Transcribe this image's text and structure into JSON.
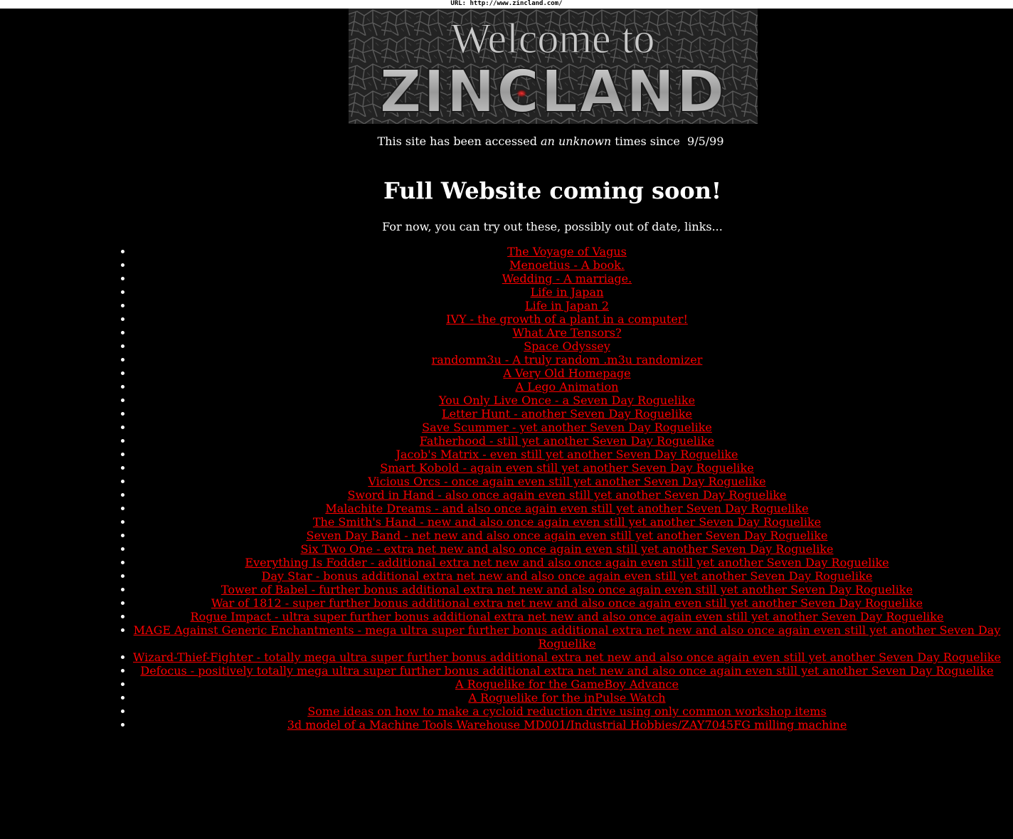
{
  "url_bar": {
    "text": "URL: http://www.zincland.com/"
  },
  "banner": {
    "line1": "Welcome to",
    "line2": "ZINCLAND"
  },
  "counter": {
    "before": "This site has been accessed ",
    "count": "an unknown",
    "after": " times since  9/5/99"
  },
  "headline": "Full Website coming soon!",
  "intro": "For now, you can try out these, possibly out of date, links...",
  "colors": {
    "background": "#000000",
    "text": "#ffffff",
    "link": "#ff0000"
  },
  "links": [
    "The Voyage of Vagus",
    "Menoetius - A book.",
    "Wedding - A marriage.",
    "Life in Japan",
    "Life in Japan 2",
    "IVY - the growth of a plant in a computer!",
    "What Are Tensors?",
    "Space Odyssey",
    "randomm3u - A truly random .m3u randomizer",
    "A Very Old Homepage",
    "A Lego Animation",
    "You Only Live Once - a Seven Day Roguelike",
    "Letter Hunt - another Seven Day Roguelike",
    "Save Scummer - yet another Seven Day Roguelike",
    "Fatherhood - still yet another Seven Day Roguelike",
    "Jacob's Matrix - even still yet another Seven Day Roguelike",
    "Smart Kobold - again even still yet another Seven Day Roguelike",
    "Vicious Orcs - once again even still yet another Seven Day Roguelike",
    "Sword in Hand - also once again even still yet another Seven Day Roguelike",
    "Malachite Dreams - and also once again even still yet another Seven Day Roguelike",
    "The Smith's Hand - new and also once again even still yet another Seven Day Roguelike",
    "Seven Day Band - net new and also once again even still yet another Seven Day Roguelike",
    "Six Two One - extra net new and also once again even still yet another Seven Day Roguelike",
    "Everything Is Fodder - additional extra net new and also once again even still yet another Seven Day Roguelike",
    "Day Star - bonus additional extra net new and also once again even still yet another Seven Day Roguelike",
    "Tower of Babel - further bonus additional extra net new and also once again even still yet another Seven Day Roguelike",
    "War of 1812 - super further bonus additional extra net new and also once again even still yet another Seven Day Roguelike",
    "Rogue Impact - ultra super further bonus additional extra net new and also once again even still yet another Seven Day Roguelike",
    "MAGE Against Generic Enchantments - mega ultra super further bonus additional extra net new and also once again even still yet another Seven Day Roguelike",
    "Wizard-Thief-Fighter - totally mega ultra super further bonus additional extra net new and also once again even still yet another Seven Day Roguelike",
    "Defocus - positively totally mega ultra super further bonus additional extra net new and also once again even still yet another Seven Day Roguelike",
    "A Roguelike for the GameBoy Advance",
    "A Roguelike for the inPulse Watch",
    "Some ideas on how to make a cycloid reduction drive using only common workshop items",
    "3d model of a Machine Tools Warehouse MD001/Industrial Hobbies/ZAY7045FG milling machine"
  ]
}
